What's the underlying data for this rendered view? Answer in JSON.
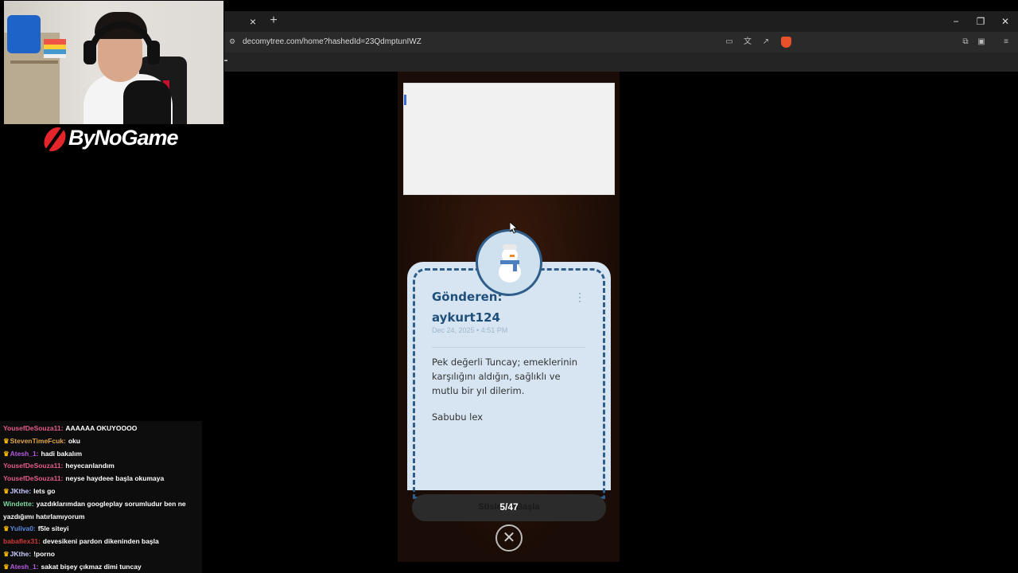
{
  "browser": {
    "tab_close": "×",
    "new_tab": "+",
    "url": "decomytree.com/home?hashedId=23QdmptunIWZ",
    "window_controls": {
      "minimize": "−",
      "restore": "❐",
      "close": "✕"
    }
  },
  "overlay": {
    "brand": "ByNoGame"
  },
  "page": {
    "card": {
      "sender_label": "Gönderen:",
      "sender_name": "aykurt124",
      "date": "Dec 24, 2025 • 4:51 PM",
      "message": "Pek değerli Tuncay; emeklerinin karşılığını aldığın, sağlıklı ve mutlu bir yıl dilerim.",
      "signature": "Sabubu lex",
      "more_icon": "⋮"
    },
    "decorate_button": "Süsle ve Başla",
    "counter": "5/47",
    "close_icon": "✕"
  },
  "chat": [
    {
      "user": "YousefDeSouza11",
      "color": "#e45a8a",
      "badge": false,
      "text": "AAAAAA OKUYOOOO"
    },
    {
      "user": "StevenTimeFcuk",
      "color": "#e0a64a",
      "badge": true,
      "text": "oku"
    },
    {
      "user": "Atesh_1",
      "color": "#b65ae0",
      "badge": true,
      "text": "hadi bakalım"
    },
    {
      "user": "YousefDeSouza11",
      "color": "#e45a8a",
      "badge": false,
      "text": "heyecanlandım"
    },
    {
      "user": "YousefDeSouza11",
      "color": "#e45a8a",
      "badge": false,
      "text": "neyse haydeee başla okumaya"
    },
    {
      "user": "JKthe",
      "color": "#c9c9ff",
      "badge": true,
      "text": "lets go"
    },
    {
      "user": "Windette",
      "color": "#7fd6a0",
      "badge": false,
      "text": "yazdıklarımdan googleplay sorumludur ben ne yazdığımı hatırlamıyorum"
    },
    {
      "user": "Yuliva0",
      "color": "#5a8ae0",
      "badge": true,
      "text": "f5le siteyi"
    },
    {
      "user": "babaflex31",
      "color": "#d43838",
      "badge": false,
      "text": "devesikeni pardon dikeninden başla"
    },
    {
      "user": "JKthe",
      "color": "#c9c9ff",
      "badge": true,
      "text": "!porno"
    },
    {
      "user": "Atesh_1",
      "color": "#b65ae0",
      "badge": true,
      "text": "sakat bişey çıkmaz dimi tuncay"
    }
  ]
}
